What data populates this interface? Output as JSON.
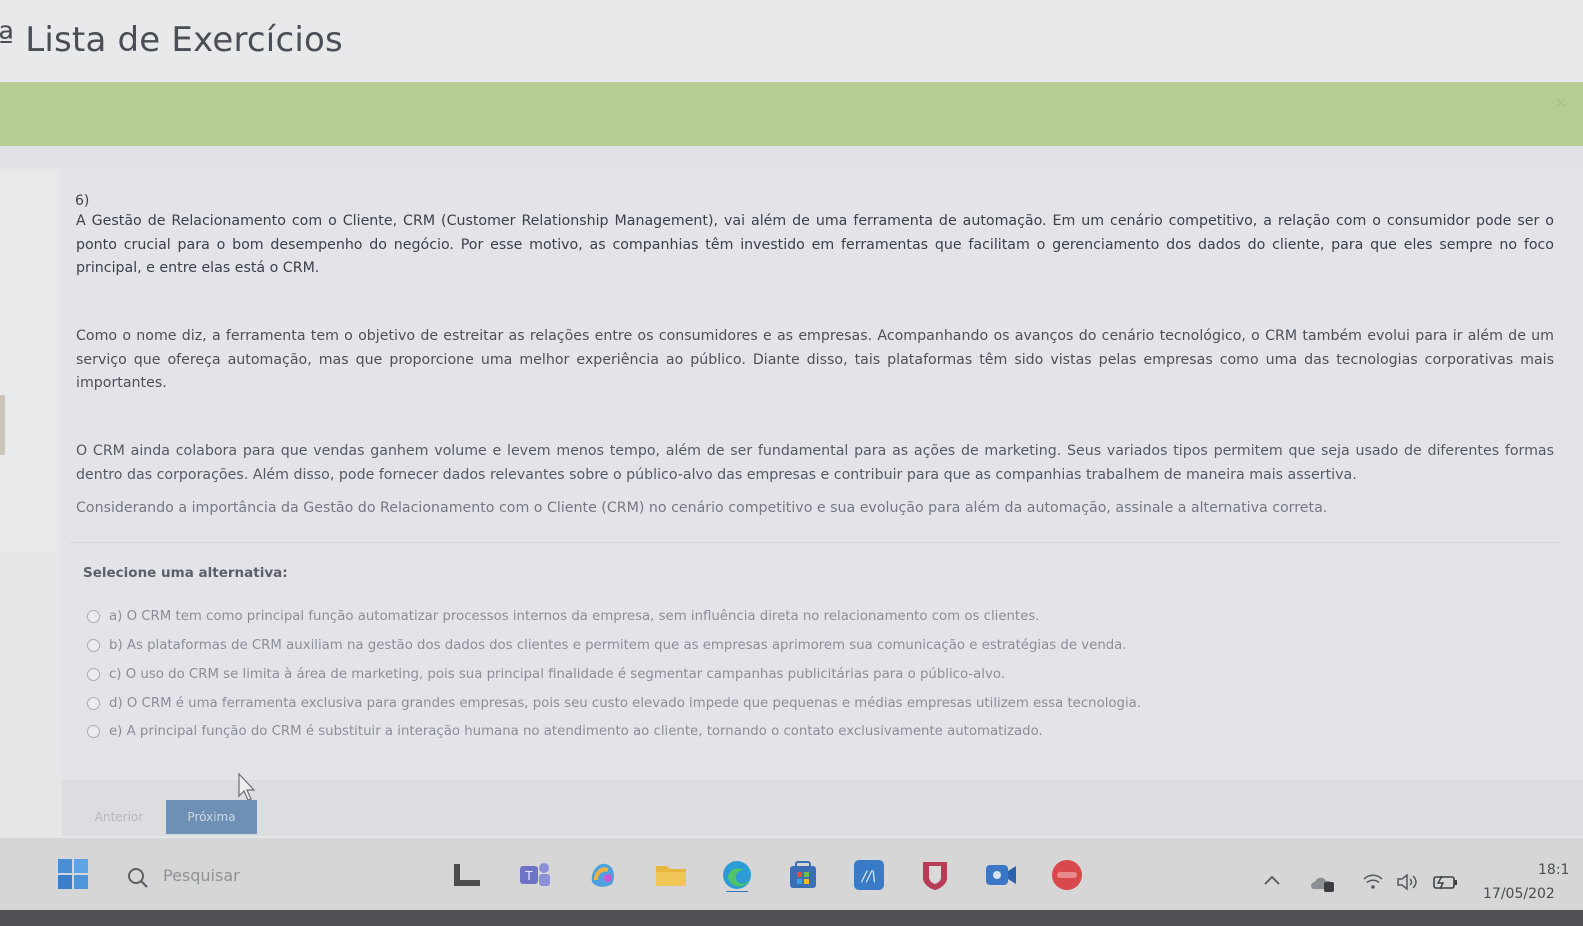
{
  "page": {
    "title": "ª Lista de Exercícios"
  },
  "question": {
    "number": "6)",
    "paragraphs": [
      "A Gestão de Relacionamento com o Cliente, CRM (Customer Relationship Management), vai além de uma ferramenta de automação. Em um cenário competitivo, a relação com o consumidor pode ser o ponto crucial para o bom desempenho do negócio. Por esse motivo, as companhias têm investido em ferramentas que facilitam o gerenciamento dos dados do cliente, para que eles sempre no foco principal, e entre elas está o CRM.",
      "Como o nome diz, a ferramenta tem o objetivo de estreitar as relações entre os consumidores e as empresas. Acompanhando os avanços do cenário tecnológico, o CRM também evolui para ir além de um serviço que ofereça automação, mas que proporcione uma melhor experiência ao público. Diante disso, tais plataformas têm sido vistas pelas empresas como uma das tecnologias corporativas mais importantes.",
      "O CRM ainda colabora para que vendas ganhem volume e levem menos tempo, além de ser fundamental para as ações de marketing. Seus variados tipos permitem que seja usado de diferentes formas dentro das corporações. Além disso, pode fornecer dados relevantes sobre o público-alvo das empresas e contribuir para que as companhias trabalhem de maneira mais assertiva.",
      "Considerando a importância da Gestão do Relacionamento com o Cliente (CRM) no cenário competitivo e sua evolução para além da automação, assinale a alternativa correta."
    ],
    "select_label": "Selecione uma alternativa:",
    "options": [
      "a) O CRM tem como principal função automatizar processos internos da empresa, sem influência direta no relacionamento com os clientes.",
      "b) As plataformas de CRM auxiliam na gestão dos dados dos clientes e permitem que as empresas aprimorem sua comunicação e estratégias de venda.",
      "c) O uso do CRM se limita à área de marketing, pois sua principal finalidade é segmentar campanhas publicitárias para o público-alvo.",
      "d) O CRM é uma ferramenta exclusiva para grandes empresas, pois seu custo elevado impede que pequenas e médias empresas utilizem essa tecnologia.",
      "e) A principal função do CRM é substituir a interação humana no atendimento ao cliente, tornando o contato exclusivamente automatizado."
    ]
  },
  "navigation": {
    "prev_label": "Anterior",
    "next_label": "Próxima"
  },
  "taskbar": {
    "search_placeholder": "Pesquisar",
    "time": "18:1",
    "date": "17/05/202",
    "icons": [
      "windows-start-icon",
      "search-icon",
      "file-icon",
      "teams-icon",
      "copilot-icon",
      "file-explorer-icon",
      "edge-icon",
      "store-icon",
      "app-icon",
      "shield-icon",
      "video-icon",
      "red-app-icon",
      "chevron-up-icon",
      "onedrive-icon",
      "wifi-icon",
      "volume-icon",
      "battery-icon"
    ]
  },
  "colors": {
    "green_bar": "#b7cc93",
    "next_button": "#6e90b4"
  }
}
